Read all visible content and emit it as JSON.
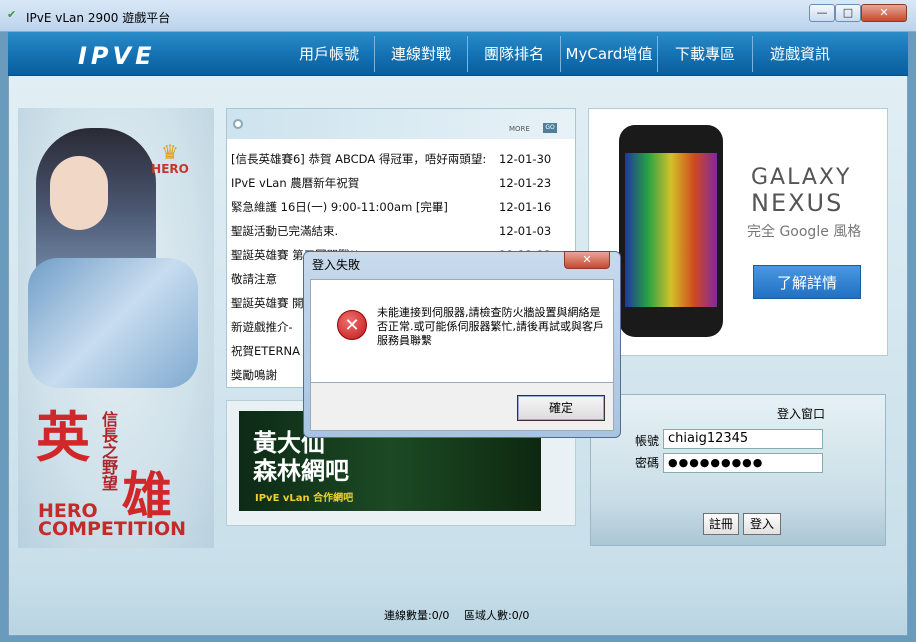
{
  "window": {
    "title": "IPvE vLan 2900 遊戲平台",
    "minimize_glyph": "—",
    "maximize_glyph": "□",
    "close_glyph": "✕"
  },
  "nav": {
    "logo": "IPVE",
    "items": [
      {
        "label": "用戶帳號"
      },
      {
        "label": "連線對戰"
      },
      {
        "label": "團隊排名"
      },
      {
        "label": "MyCard增值"
      },
      {
        "label": "下載專區"
      },
      {
        "label": "遊戲資訊"
      }
    ]
  },
  "hero": {
    "badge": "HERO",
    "title_big": "英",
    "title_big2": "雄",
    "subtitle": "信長之野望",
    "en_line1": "HERO",
    "en_line2": "COMPETITION"
  },
  "news": {
    "more_label": "MORE",
    "go_label": "GO",
    "items": [
      {
        "title": "[信長英雄賽6] 恭賀 ABCDA 得冠軍，唔好兩頭望:",
        "date": "12-01-30"
      },
      {
        "title": "IPvE vLan 農曆新年祝賀",
        "date": "12-01-23"
      },
      {
        "title": "緊急維護 16日(一) 9:00-11:00am [完畢]",
        "date": "12-01-16"
      },
      {
        "title": "聖誕活動已完滿結束.",
        "date": "12-01-03"
      },
      {
        "title": "聖誕英雄賽 第三回開戰!!",
        "date": "11-12-23"
      },
      {
        "title": "敬請注意",
        "date": ""
      },
      {
        "title": "聖誕英雄賽 開",
        "date": ""
      },
      {
        "title": "新遊戲推介-",
        "date": ""
      },
      {
        "title": "祝賀ETERNA",
        "date": ""
      },
      {
        "title": "獎勵鳴謝",
        "date": ""
      }
    ]
  },
  "banner": {
    "line1": "黃大仙",
    "line2": "森林網吧",
    "tagline": "IPvE vLan 合作網吧"
  },
  "ad": {
    "brand1": "GALAXY",
    "brand2": "NEXUS",
    "slogan": "完全 Google 風格",
    "cta": "了解詳情"
  },
  "login": {
    "title": "登入窗口",
    "account_label": "帳號",
    "account_value": "chiaig12345",
    "password_label": "密碼",
    "password_value": "●●●●●●●●●",
    "register_label": "註冊",
    "login_label": "登入"
  },
  "status": {
    "connections": "連線數量:0/0",
    "lan_users": "區域人數:0/0"
  },
  "dialog": {
    "title": "登入失敗",
    "close_glyph": "✕",
    "icon_glyph": "✕",
    "message": "未能連接到伺服器,請檢查防火牆設置與網絡是否正常.或可能係伺服器繁忙,請後再試或與客戶服務員聯繫",
    "ok_label": "確定"
  },
  "colors": {
    "nav_bg": "#1573b4",
    "error_red": "#c01818",
    "cta_blue": "#2070c4"
  }
}
